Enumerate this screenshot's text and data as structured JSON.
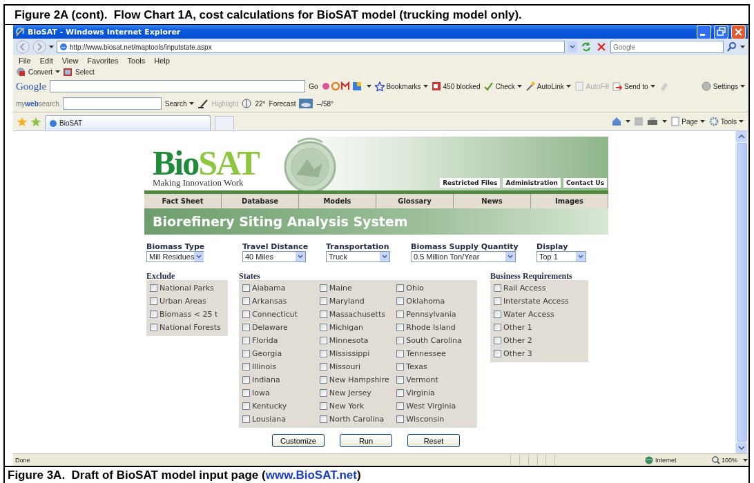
{
  "figure_title": "Figure 2A (cont).  Flow Chart 1A, cost calculations for BioSAT model (trucking model only).",
  "browser": {
    "title": "BioSAT - Windows Internet Explorer",
    "address": "http://www.biosat.net/maptools/inputstate.aspx",
    "search_placeholder": "Google",
    "menu": [
      "File",
      "Edit",
      "View",
      "Favorites",
      "Tools",
      "Help"
    ],
    "links": [
      "Convert",
      "Select"
    ],
    "google_toolbar": {
      "logo": "Google",
      "items": [
        {
          "label": "Go",
          "menu": false,
          "disabled": false
        },
        {
          "label": "Bookmarks",
          "menu": true,
          "disabled": false
        },
        {
          "label": "450 blocked",
          "menu": false,
          "disabled": false
        },
        {
          "label": "Check",
          "menu": true,
          "disabled": false
        },
        {
          "label": "AutoLink",
          "menu": true,
          "disabled": false
        },
        {
          "label": "AutoFill",
          "menu": false,
          "disabled": true
        },
        {
          "label": "Send to",
          "menu": true,
          "disabled": false
        }
      ],
      "settings": "Settings"
    },
    "websearch_toolbar": {
      "logo": "my**web**search",
      "items": [
        {
          "label": "Search",
          "menu": true,
          "disabled": false
        },
        {
          "label": "Highlight",
          "menu": false,
          "disabled": true
        },
        {
          "label": "22°",
          "menu": false,
          "disabled": false
        },
        {
          "label": "Forecast",
          "menu": false,
          "disabled": false
        },
        {
          "label": "--/58°",
          "menu": false,
          "disabled": false
        }
      ]
    },
    "tab": {
      "label": "BioSAT",
      "selected": true
    },
    "command_bar": [
      "Page",
      "Tools"
    ],
    "status_bar": {
      "text": "Done",
      "zone": "Internet",
      "zoom": "100%"
    }
  },
  "site": {
    "logo_parts": [
      "Bio",
      "SAT"
    ],
    "tagline": "Making Innovation Work",
    "top_links": [
      "Restricted Files",
      "Administration",
      "Contact Us"
    ],
    "nav": [
      "Fact Sheet",
      "Database",
      "Models",
      "Glossary",
      "News",
      "Images"
    ],
    "heading": "Biorefinery Siting Analysis System",
    "dropdowns": [
      {
        "label": "Biomass Type",
        "value": "Mill Residues"
      },
      {
        "label": "Travel Distance",
        "value": "40 Miles"
      },
      {
        "label": "Transportation",
        "value": "Truck"
      },
      {
        "label": "Biomass Supply Quantity",
        "value": "0.5 Million Ton/Year"
      },
      {
        "label": "Display",
        "value": "Top 1"
      }
    ],
    "exclude": {
      "title": "Exclude",
      "options": [
        {
          "label": "National Parks",
          "checked": false
        },
        {
          "label": "Urban Areas",
          "checked": false
        },
        {
          "label": "Biomass < 25 t",
          "checked": false
        },
        {
          "label": "National Forests",
          "checked": false
        }
      ]
    },
    "states": {
      "title": "States",
      "columns": [
        [
          {
            "label": "Alabama",
            "checked": false
          },
          {
            "label": "Arkansas",
            "checked": false
          },
          {
            "label": "Connecticut",
            "checked": false
          },
          {
            "label": "Delaware",
            "checked": false
          },
          {
            "label": "Florida",
            "checked": false
          },
          {
            "label": "Georgia",
            "checked": false
          },
          {
            "label": "Illinois",
            "checked": false
          },
          {
            "label": "Indiana",
            "checked": false
          },
          {
            "label": "Iowa",
            "checked": false
          },
          {
            "label": "Kentucky",
            "checked": false
          },
          {
            "label": "Lousiana",
            "checked": false
          }
        ],
        [
          {
            "label": "Maine",
            "checked": false
          },
          {
            "label": "Maryland",
            "checked": false
          },
          {
            "label": "Massachusetts",
            "checked": false
          },
          {
            "label": "Michigan",
            "checked": false
          },
          {
            "label": "Minnesota",
            "checked": false
          },
          {
            "label": "Mississippi",
            "checked": false
          },
          {
            "label": "Missouri",
            "checked": false
          },
          {
            "label": "New Hampshire",
            "checked": false
          },
          {
            "label": "New Jersey",
            "checked": false
          },
          {
            "label": "New York",
            "checked": false
          },
          {
            "label": "North Carolina",
            "checked": false
          }
        ],
        [
          {
            "label": "Ohio",
            "checked": false
          },
          {
            "label": "Oklahoma",
            "checked": false
          },
          {
            "label": "Pennsylvania",
            "checked": false
          },
          {
            "label": "Rhode Island",
            "checked": false
          },
          {
            "label": "South Carolina",
            "checked": false
          },
          {
            "label": "Tennessee",
            "checked": false
          },
          {
            "label": "Texas",
            "checked": false
          },
          {
            "label": "Vermont",
            "checked": false
          },
          {
            "label": "Virginia",
            "checked": false
          },
          {
            "label": "West Virginia",
            "checked": false
          },
          {
            "label": "Wisconsin",
            "checked": false
          }
        ]
      ]
    },
    "business": {
      "title": "Business Requirements",
      "options": [
        {
          "label": "Rail Access",
          "checked": false
        },
        {
          "label": "Interstate Access",
          "checked": false
        },
        {
          "label": "Water Access",
          "checked": false
        },
        {
          "label": "Other 1",
          "checked": false
        },
        {
          "label": "Other 2",
          "checked": false
        },
        {
          "label": "Other 3",
          "checked": false
        }
      ]
    },
    "buttons": [
      "Customize",
      "Run",
      "Reset"
    ]
  },
  "figure_caption": {
    "text": "Figure 3A.  Draft of BioSAT model input page (",
    "link": "www.BioSAT.net",
    "after": ")"
  }
}
